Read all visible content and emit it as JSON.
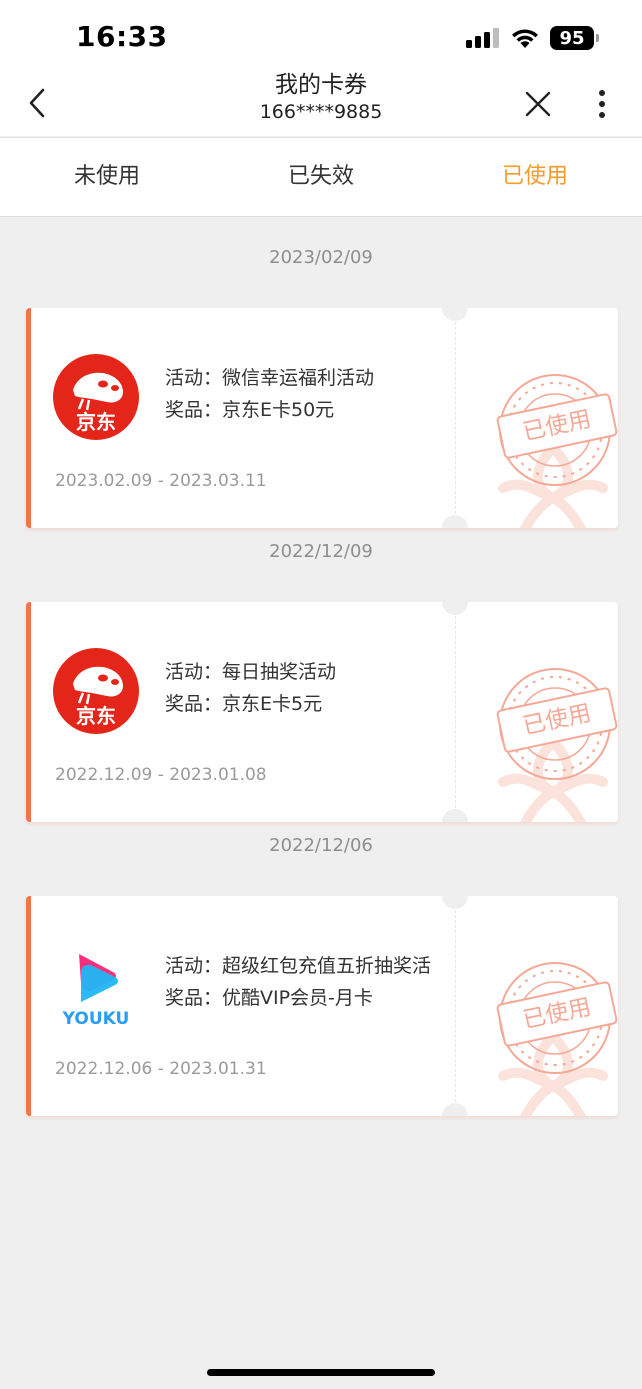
{
  "status": {
    "time": "16:33",
    "battery": "95"
  },
  "nav": {
    "title": "我的卡券",
    "subtitle": "166****9885"
  },
  "tabs": [
    {
      "label": "未使用",
      "active": false
    },
    {
      "label": "已失效",
      "active": false
    },
    {
      "label": "已使用",
      "active": true
    }
  ],
  "coupons": [
    {
      "date": "2023/02/09",
      "brand": "京东",
      "activity": "活动：微信幸运福利活动",
      "prize": "奖品：京东E卡50元",
      "period": "2023.02.09 - 2023.03.11",
      "status": "已使用"
    },
    {
      "date": "2022/12/09",
      "brand": "京东",
      "activity": "活动：每日抽奖活动",
      "prize": "奖品：京东E卡5元",
      "period": "2022.12.09 - 2023.01.08",
      "status": "已使用"
    },
    {
      "date": "2022/12/06",
      "brand": "YOUKU",
      "activity": "活动：超级红包充值五折抽奖活",
      "prize": "奖品：优酷VIP会员-月卡",
      "period": "2022.12.06 - 2023.01.31",
      "status": "已使用"
    }
  ],
  "colors": {
    "accent": "#f39c2e",
    "card_border": "#f4734b",
    "stamp": "#f5a896",
    "jd_red": "#e4251a"
  }
}
